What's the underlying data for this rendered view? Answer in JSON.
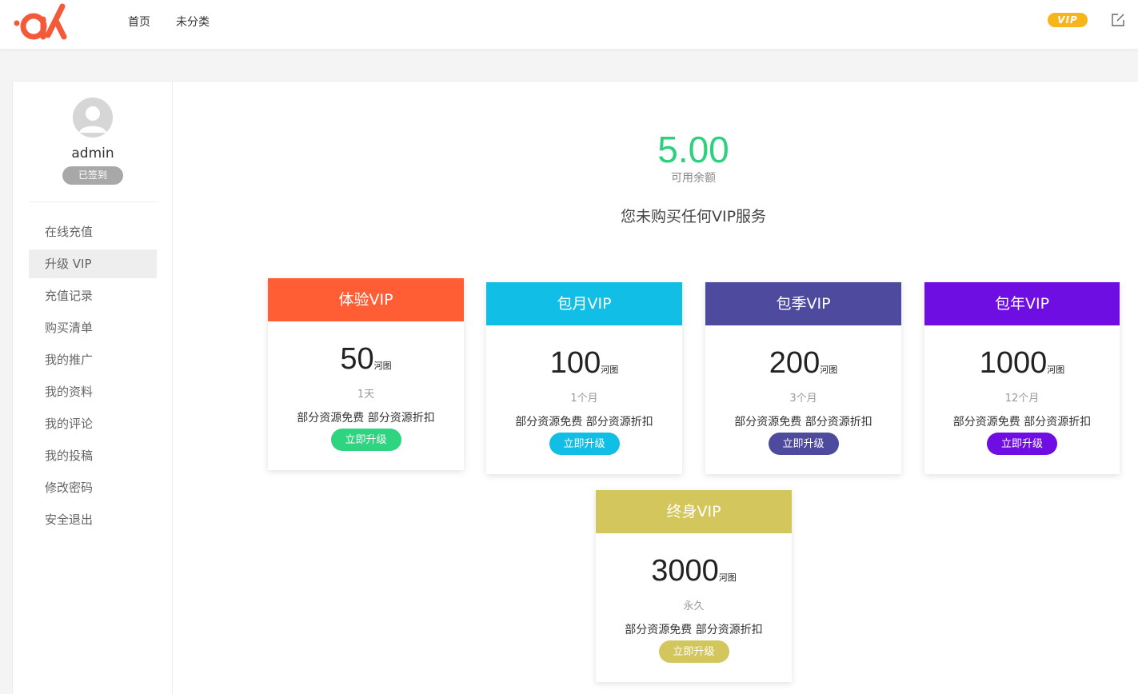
{
  "header": {
    "nav": [
      "首页",
      "未分类"
    ],
    "vip_label": "VIP",
    "brand_color": "#f35a3a"
  },
  "sidebar": {
    "username": "admin",
    "signed_badge": "已签到",
    "menu": [
      {
        "label": "在线充值",
        "active": false
      },
      {
        "label": "升级 VIP",
        "active": true
      },
      {
        "label": "充值记录",
        "active": false
      },
      {
        "label": "购买清单",
        "active": false
      },
      {
        "label": "我的推广",
        "active": false
      },
      {
        "label": "我的资料",
        "active": false
      },
      {
        "label": "我的评论",
        "active": false
      },
      {
        "label": "我的投稿",
        "active": false
      },
      {
        "label": "修改密码",
        "active": false
      },
      {
        "label": "安全退出",
        "active": false
      }
    ]
  },
  "balance": {
    "value": "5.00",
    "label": "可用余额"
  },
  "status_text": "您未购买任何VIP服务",
  "plans": [
    {
      "title": "体验VIP",
      "price": "50",
      "unit": "河图",
      "duration": "1天",
      "desc": "部分资源免费 部分资源折扣",
      "button": "立即升级",
      "head_color": "#ff5e35",
      "button_color": "#2ed47f"
    },
    {
      "title": "包月VIP",
      "price": "100",
      "unit": "河图",
      "duration": "1个月",
      "desc": "部分资源免费 部分资源折扣",
      "button": "立即升级",
      "head_color": "#11bfe6",
      "button_color": "#11bfe6"
    },
    {
      "title": "包季VIP",
      "price": "200",
      "unit": "河图",
      "duration": "3个月",
      "desc": "部分资源免费 部分资源折扣",
      "button": "立即升级",
      "head_color": "#4e4a9e",
      "button_color": "#4e4a9e"
    },
    {
      "title": "包年VIP",
      "price": "1000",
      "unit": "河图",
      "duration": "12个月",
      "desc": "部分资源免费 部分资源折扣",
      "button": "立即升级",
      "head_color": "#6f0ee3",
      "button_color": "#6f0ee3"
    },
    {
      "title": "终身VIP",
      "price": "3000",
      "unit": "河图",
      "duration": "永久",
      "desc": "部分资源免费 部分资源折扣",
      "button": "立即升级",
      "head_color": "#d3c65c",
      "button_color": "#d3c65c"
    }
  ]
}
